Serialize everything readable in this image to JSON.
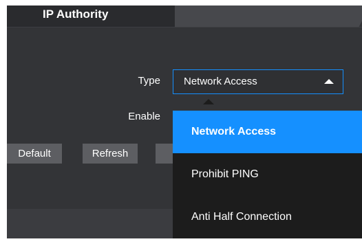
{
  "panel": {
    "title": "IP Authority"
  },
  "form": {
    "type_label": "Type",
    "type_value": "Network Access",
    "enable_label": "Enable"
  },
  "dropdown": {
    "options": [
      {
        "label": "Network Access",
        "selected": true
      },
      {
        "label": "Prohibit PING",
        "selected": false
      },
      {
        "label": "Anti Half Connection",
        "selected": false
      }
    ]
  },
  "buttons": {
    "default_label": "Default",
    "refresh_label": "Refresh"
  },
  "icons": {
    "select_arrow": "triangle-up-icon",
    "dropdown_caret": "dropdown-caret-icon"
  },
  "colors": {
    "accent": "#1590ff",
    "panel_background": "#333437",
    "dropdown_background": "#1c1c1c",
    "button_background": "#5d5e62",
    "text": "#ffffff"
  }
}
